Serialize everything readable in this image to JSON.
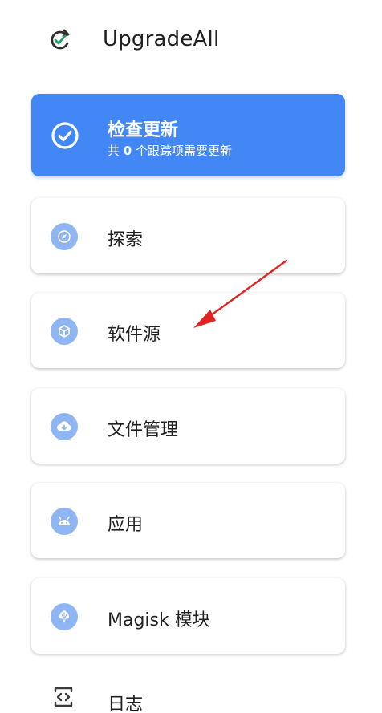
{
  "app": {
    "title": "UpgradeAll"
  },
  "update_card": {
    "title": "检查更新",
    "subtitle_prefix": "共 ",
    "count": "0",
    "subtitle_suffix": " 个跟踪项需要更新"
  },
  "menu": [
    {
      "id": "explore",
      "label": "探索",
      "icon": "compass-icon"
    },
    {
      "id": "sources",
      "label": "软件源",
      "icon": "cube-icon"
    },
    {
      "id": "files",
      "label": "文件管理",
      "icon": "cloud-download-icon"
    },
    {
      "id": "apps",
      "label": "应用",
      "icon": "android-icon"
    },
    {
      "id": "magisk",
      "label": "Magisk 模块",
      "icon": "magisk-icon"
    }
  ],
  "log": {
    "label": "日志",
    "icon": "code-icon"
  },
  "colors": {
    "primary": "#4287f5",
    "icon_bg": "#8fb6f2",
    "arrow": "#e02424"
  }
}
